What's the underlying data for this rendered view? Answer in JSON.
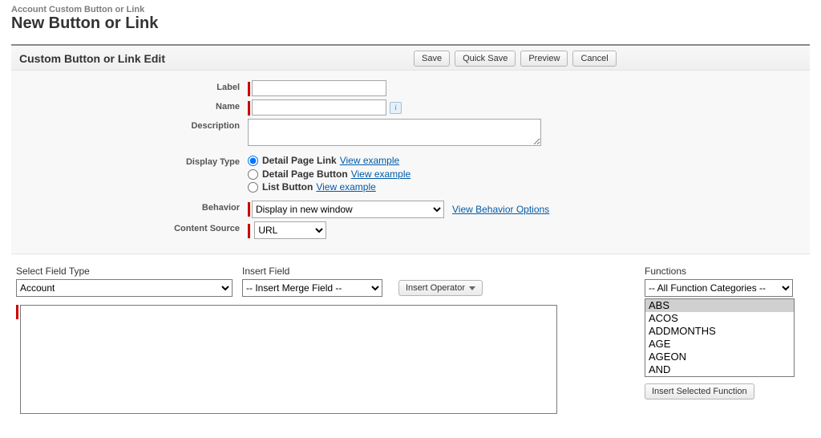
{
  "breadcrumb": "Account Custom Button or Link",
  "title": "New Button or Link",
  "panel_title": "Custom Button or Link Edit",
  "toolbar": {
    "save": "Save",
    "quick_save": "Quick Save",
    "preview": "Preview",
    "cancel": "Cancel"
  },
  "form": {
    "label_lbl": "Label",
    "label_val": "",
    "name_lbl": "Name",
    "name_val": "",
    "desc_lbl": "Description",
    "desc_val": "",
    "display_type_lbl": "Display Type",
    "display_type": {
      "opt1": "Detail Page Link",
      "opt2": "Detail Page Button",
      "opt3": "List Button",
      "example": "View example",
      "selected": "opt1"
    },
    "behavior_lbl": "Behavior",
    "behavior_val": "Display in new window",
    "behavior_link": "View Behavior Options",
    "content_lbl": "Content Source",
    "content_val": "URL"
  },
  "builder": {
    "field_type_lbl": "Select Field Type",
    "field_type_val": "Account",
    "insert_field_lbl": "Insert Field",
    "merge_val": "-- Insert Merge Field --",
    "insert_operator": "Insert Operator",
    "functions_lbl": "Functions",
    "func_cat": "-- All Function Categories --",
    "func_list": [
      "ABS",
      "ACOS",
      "ADDMONTHS",
      "AGE",
      "AGEON",
      "AND"
    ],
    "selected_func": "ABS",
    "insert_func_btn": "Insert Selected Function",
    "formula_val": ""
  }
}
